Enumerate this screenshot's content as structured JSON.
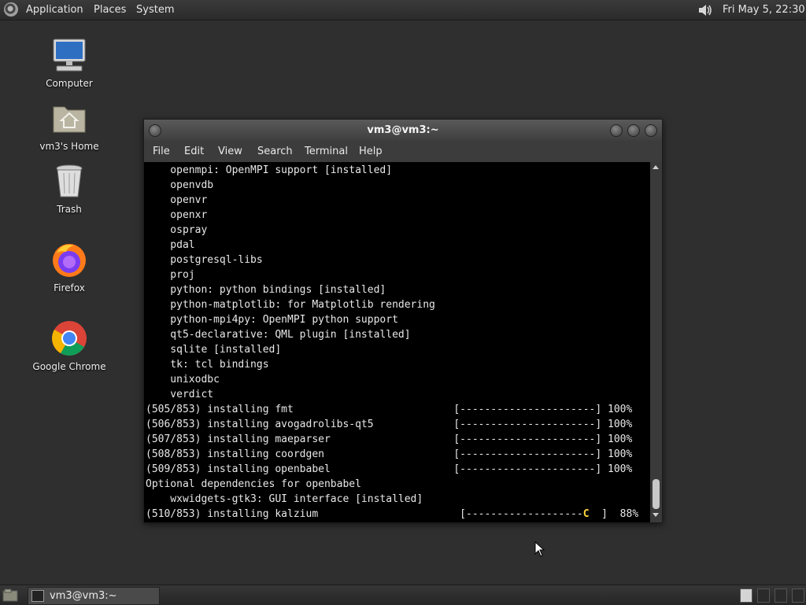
{
  "top_panel": {
    "applications_label": "Applications",
    "places_label": "Places",
    "system_label": "System",
    "clock": "Fri May  5, 22:30"
  },
  "desktop_icons": [
    {
      "label": "Computer",
      "icon": "computer-icon"
    },
    {
      "label": "vm3's Home",
      "icon": "home-folder-icon"
    },
    {
      "label": "Trash",
      "icon": "trash-icon"
    },
    {
      "label": "Firefox",
      "icon": "firefox-icon"
    },
    {
      "label": "Google Chrome",
      "icon": "chrome-icon"
    }
  ],
  "terminal": {
    "title": "vm3@vm3:~",
    "menu": [
      "File",
      "Edit",
      "View",
      "Search",
      "Terminal",
      "Help"
    ],
    "lines": [
      "    openmpi: OpenMPI support [installed]",
      "    openvdb",
      "    openvr",
      "    openxr",
      "    ospray",
      "    pdal",
      "    postgresql-libs",
      "    proj",
      "    python: python bindings [installed]",
      "    python-matplotlib: for Matplotlib rendering",
      "    python-mpi4py: OpenMPI python support",
      "    qt5-declarative: QML plugin [installed]",
      "    sqlite [installed]",
      "    tk: tcl bindings",
      "    unixodbc",
      "    verdict",
      "(505/853) installing fmt                          [----------------------] 100%",
      "(506/853) installing avogadrolibs-qt5             [----------------------] 100%",
      "(507/853) installing maeparser                    [----------------------] 100%",
      "(508/853) installing coordgen                     [----------------------] 100%",
      "(509/853) installing openbabel                    [----------------------] 100%",
      "Optional dependencies for openbabel",
      "    wxwidgets-gtk3: GUI interface [installed]"
    ],
    "last_line_prefix": "(510/853) installing kalzium                       [-------------------",
    "last_line_cursor": "C",
    "last_line_suffix": "  ]  88%"
  },
  "taskbar": {
    "task_label": "vm3@vm3:~"
  },
  "colors": {
    "desktop_bg": "#2f2f2f",
    "terminal_bg": "#000000",
    "terminal_fg": "#e8e8e8",
    "cursor_color": "#ffd93a"
  }
}
